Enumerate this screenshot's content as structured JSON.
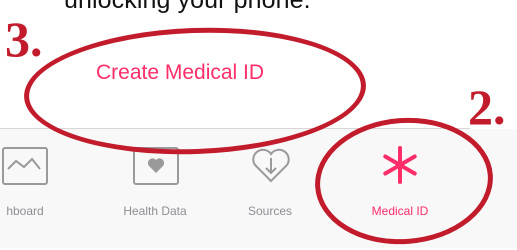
{
  "instruction_text": "unlocking your phone.",
  "annotations": {
    "step_three": "3.",
    "step_two": "2."
  },
  "create_link": "Create Medical ID",
  "tabs": [
    {
      "label": "hboard",
      "icon": "dashboard-icon"
    },
    {
      "label": "Health Data",
      "icon": "heart-icon"
    },
    {
      "label": "Sources",
      "icon": "download-heart-icon"
    },
    {
      "label": "Medical ID",
      "icon": "asterisk-icon",
      "selected": true
    }
  ],
  "colors": {
    "accent": "#ff2d68",
    "annotation": "#c11b2c",
    "inactive": "#8e8e93"
  }
}
